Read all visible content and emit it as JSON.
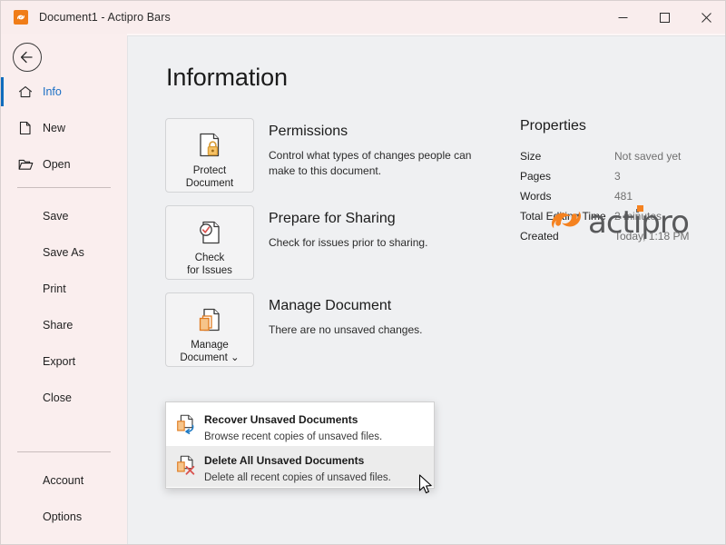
{
  "window": {
    "title": "Document1 - Actipro Bars",
    "app_icon": "actipro-swirl-icon",
    "minimize_label": "—",
    "maximize_label": "□",
    "close_label": "✕"
  },
  "backstage": {
    "back_button": "back-arrow-icon",
    "nav": [
      {
        "label": "Info",
        "icon": "home-icon",
        "selected": true,
        "indented": false
      },
      {
        "label": "New",
        "icon": "page-icon",
        "selected": false,
        "indented": false
      },
      {
        "label": "Open",
        "icon": "folder-icon",
        "selected": false,
        "indented": false
      },
      {
        "label": "Save",
        "icon": "",
        "selected": false,
        "indented": true
      },
      {
        "label": "Save As",
        "icon": "",
        "selected": false,
        "indented": true
      },
      {
        "label": "Print",
        "icon": "",
        "selected": false,
        "indented": true
      },
      {
        "label": "Share",
        "icon": "",
        "selected": false,
        "indented": true
      },
      {
        "label": "Export",
        "icon": "",
        "selected": false,
        "indented": true
      },
      {
        "label": "Close",
        "icon": "",
        "selected": false,
        "indented": true
      },
      {
        "label": "Account",
        "icon": "",
        "selected": false,
        "indented": true
      },
      {
        "label": "Options",
        "icon": "",
        "selected": false,
        "indented": true
      }
    ]
  },
  "page": {
    "title": "Information",
    "sections": [
      {
        "button_caption_line1": "Protect",
        "button_caption_line2": "Document",
        "button_icon": "document-lock-icon",
        "heading": "Permissions",
        "description": "Control what types of changes people can make to this document."
      },
      {
        "button_caption_line1": "Check",
        "button_caption_line2": "for Issues",
        "button_icon": "document-check-icon",
        "heading": "Prepare for Sharing",
        "description": "Check for issues prior to sharing."
      },
      {
        "button_caption_line1": "Manage",
        "button_caption_line2": "Document",
        "button_icon": "document-copies-icon",
        "has_chevron": true,
        "heading": "Manage Document",
        "description": "There are no unsaved changes."
      }
    ],
    "properties": {
      "heading": "Properties",
      "rows": [
        {
          "name": "Size",
          "value": "Not saved yet"
        },
        {
          "name": "Pages",
          "value": "3"
        },
        {
          "name": "Words",
          "value": "481"
        },
        {
          "name": "Total Editing Time",
          "value": "2 minutes"
        },
        {
          "name": "Created",
          "value": "Today, 1:18 PM"
        }
      ]
    },
    "logo": {
      "mark": "actipro-swirl-logo",
      "word": "actipro"
    }
  },
  "menu": {
    "items": [
      {
        "icon": "recover-document-icon",
        "title": "Recover Unsaved Documents",
        "subtitle": "Browse recent copies of unsaved files.",
        "highlighted": false
      },
      {
        "icon": "delete-document-icon",
        "title": "Delete All Unsaved Documents",
        "subtitle": "Delete all recent copies of unsaved files.",
        "highlighted": true
      }
    ]
  },
  "colors": {
    "accent_blue": "#0f6cbd",
    "brand_orange": "#f07d18",
    "sidebar_bg": "#faeeee",
    "content_bg": "#eff0f2",
    "titlebar_bg": "#f9eded"
  }
}
